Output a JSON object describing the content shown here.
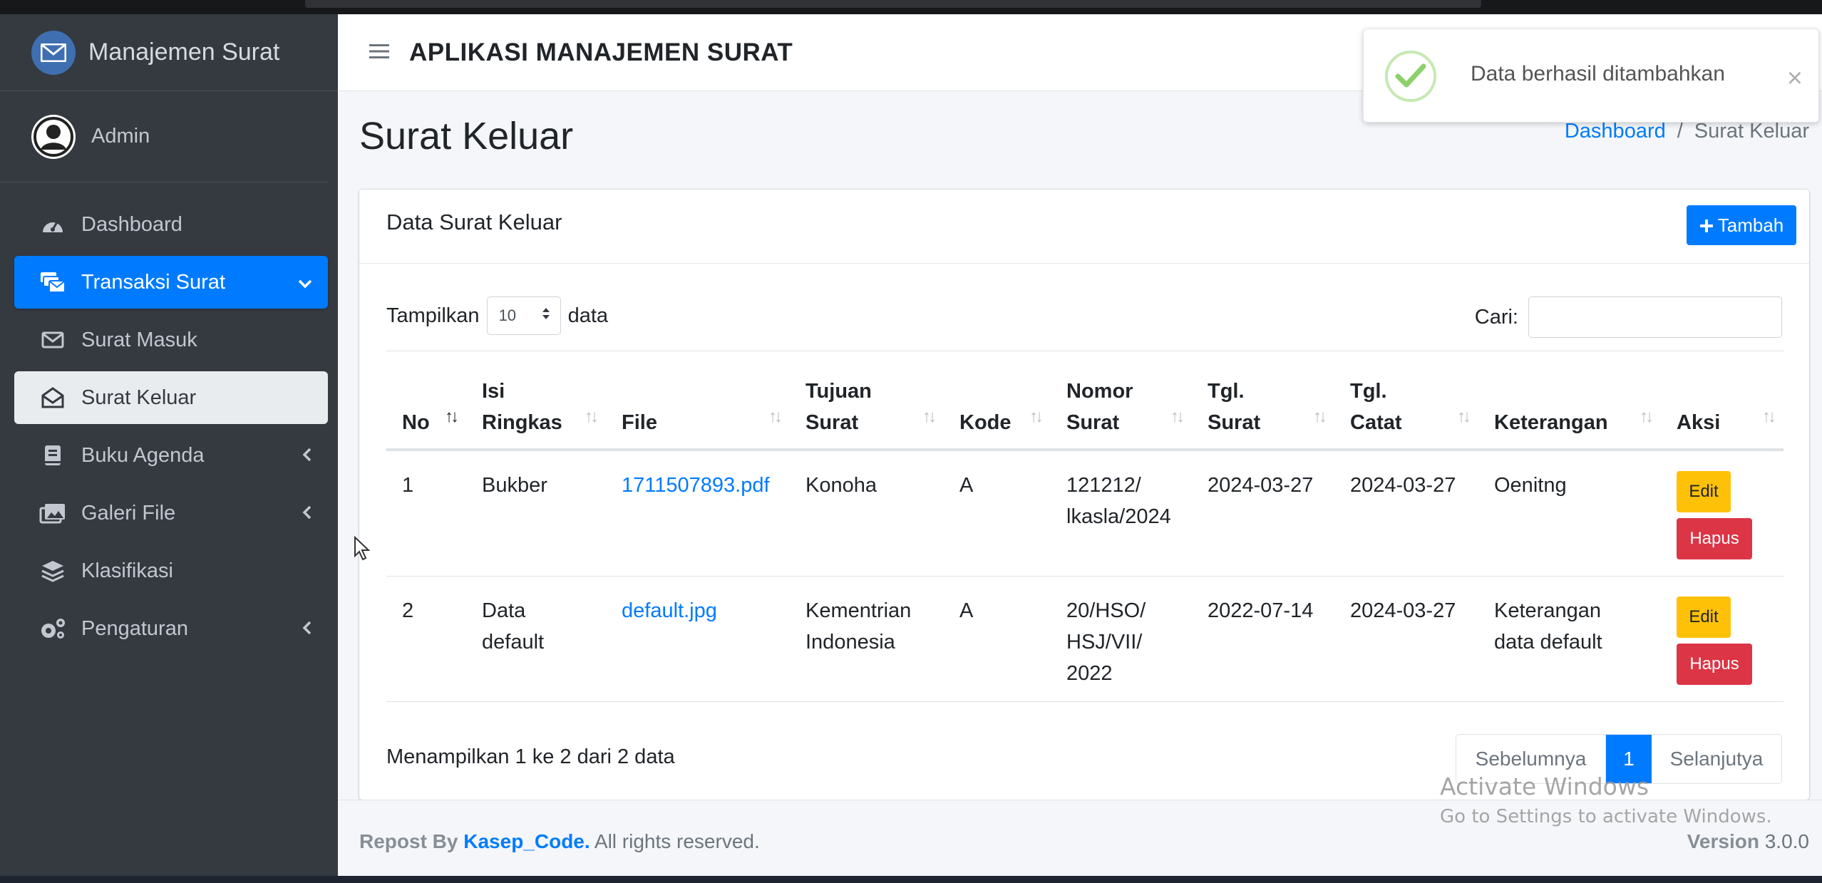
{
  "brand": {
    "title": "Manajemen Surat",
    "icon": "envelope-icon"
  },
  "user": {
    "name": "Admin"
  },
  "sidebar": {
    "items": [
      {
        "label": "Dashboard",
        "icon": "tachometer-icon"
      },
      {
        "label": "Transaksi Surat",
        "icon": "mail-bulk-icon",
        "state": "active",
        "chevron": "down"
      },
      {
        "label": "Surat Masuk",
        "icon": "envelope-icon"
      },
      {
        "label": "Surat Keluar",
        "icon": "envelope-open-icon",
        "state": "selected"
      },
      {
        "label": "Buku Agenda",
        "icon": "book-icon",
        "chevron": "left"
      },
      {
        "label": "Galeri File",
        "icon": "images-icon",
        "chevron": "left"
      },
      {
        "label": "Klasifikasi",
        "icon": "layer-group-icon"
      },
      {
        "label": "Pengaturan",
        "icon": "cogs-icon",
        "chevron": "left"
      }
    ]
  },
  "header": {
    "menu_icon": "hamburger-icon",
    "title": "APLIKASI MANAJEMEN SURAT"
  },
  "page": {
    "title": "Surat Keluar"
  },
  "breadcrumb": {
    "home": "Dashboard",
    "separator": "/",
    "current": "Surat Keluar"
  },
  "card": {
    "title": "Data Surat Keluar",
    "add_button": "Tambah",
    "length": {
      "prefix": "Tampilkan",
      "value": "10",
      "suffix": "data"
    },
    "search": {
      "label": "Cari:",
      "value": ""
    }
  },
  "table": {
    "headers": [
      {
        "label": "No"
      },
      {
        "label": "Isi Ringkas"
      },
      {
        "label": "File"
      },
      {
        "label": "Tujuan Surat"
      },
      {
        "label": "Kode"
      },
      {
        "label": "Nomor Surat"
      },
      {
        "label": "Tgl. Surat"
      },
      {
        "label": "Tgl. Catat"
      },
      {
        "label": "Keterangan"
      },
      {
        "label": "Aksi"
      }
    ],
    "rows": [
      {
        "no": "1",
        "isi": "Bukber",
        "file": "1711507893.pdf",
        "tujuan": "Konoha",
        "kode": "A",
        "nomor": "121212/ lkasla/2024",
        "tgl_surat": "2024-03-27",
        "tgl_catat": "2024-03-27",
        "keterangan": "Oenitng"
      },
      {
        "no": "2",
        "isi": "Data default",
        "file": "default.jpg",
        "tujuan": "Kementrian Indonesia",
        "kode": "A",
        "nomor": "20/HSO/ HSJ/VII/ 2022",
        "tgl_surat": "2022-07-14",
        "tgl_catat": "2024-03-27",
        "keterangan": "Keterangan data default"
      }
    ],
    "actions": {
      "edit": "Edit",
      "delete": "Hapus"
    }
  },
  "info": "Menampilkan 1 ke 2 dari 2 data",
  "pagination": {
    "prev": "Sebelumnya",
    "current": "1",
    "next": "Selanjutya"
  },
  "footer": {
    "prefix": "Repost By",
    "brand": "Kasep_Code.",
    "rights": "All rights reserved.",
    "version_label": "Version",
    "version": "3.0.0"
  },
  "watermark": {
    "line1": "Activate Windows",
    "line2": "Go to Settings to activate Windows."
  },
  "toast": {
    "message": "Data berhasil ditambahkan",
    "close": "×"
  },
  "colors": {
    "primary": "#007bff",
    "sidebar": "#343a40",
    "warning": "#ffc107",
    "danger": "#dc3545",
    "success": "#8cd06a"
  }
}
